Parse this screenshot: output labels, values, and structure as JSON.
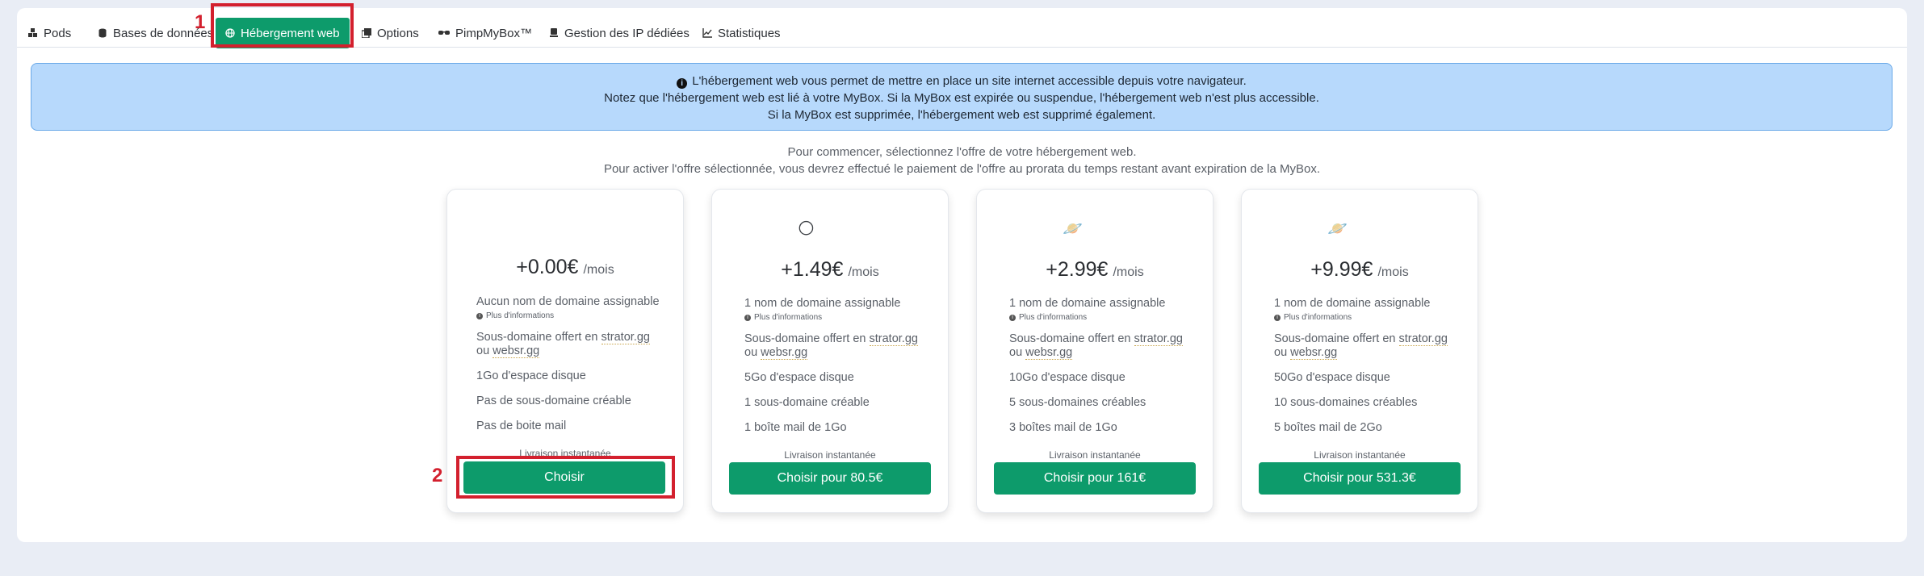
{
  "tabs": [
    {
      "label": "Pods",
      "icon": "pods-icon"
    },
    {
      "label": "Bases de données",
      "icon": "database-icon"
    },
    {
      "label": "Hébergement web",
      "icon": "globe-icon",
      "active": true
    },
    {
      "label": "Options",
      "icon": "options-icon"
    },
    {
      "label": "PimpMyBox™",
      "icon": "glasses-icon"
    },
    {
      "label": "Gestion des IP dédiées",
      "icon": "ip-icon"
    },
    {
      "label": "Statistiques",
      "icon": "chart-icon"
    }
  ],
  "annotations": {
    "one": "1",
    "two": "2"
  },
  "info": {
    "line1": "L'hébergement web vous permet de mettre en place un site internet accessible depuis votre navigateur.",
    "line2": "Notez que l'hébergement web est lié à votre MyBox. Si la MyBox est expirée ou suspendue, l'hébergement web n'est plus accessible.",
    "line3": "Si la MyBox est supprimée, l'hébergement web est supprimé également."
  },
  "intro": {
    "line1": "Pour commencer, sélectionnez l'offre de votre hébergement web.",
    "line2": "Pour activer l'offre sélectionnée, vous devrez effectué le paiement de l'offre au prorata du temps restant avant expiration de la MyBox."
  },
  "plans": [
    {
      "planet": "",
      "price": "+0.00€",
      "period": "/mois",
      "domain": "Aucun nom de domaine assignable",
      "more": "Plus d'informations",
      "sub_a": "Sous-domaine offert en ",
      "sub_b": "strator.gg",
      "sub_c": "ou ",
      "sub_d": "websr.gg",
      "disk": "1Go d'espace disque",
      "subdomains": "Pas de sous-domaine créable",
      "mail": "Pas de boite mail",
      "livraison": "Livraison instantanée",
      "button": "Choisir"
    },
    {
      "planet": "🌕",
      "price": "+1.49€",
      "period": "/mois",
      "domain": "1 nom de domaine assignable",
      "more": "Plus d'informations",
      "sub_a": "Sous-domaine offert en ",
      "sub_b": "strator.gg",
      "sub_c": "ou ",
      "sub_d": "websr.gg",
      "disk": "5Go d'espace disque",
      "subdomains": "1 sous-domaine créable",
      "mail": "1 boîte mail de 1Go",
      "livraison": "Livraison instantanée",
      "button": "Choisir pour 80.5€"
    },
    {
      "planet": "🪐",
      "price": "+2.99€",
      "period": "/mois",
      "domain": "1 nom de domaine assignable",
      "more": "Plus d'informations",
      "sub_a": "Sous-domaine offert en ",
      "sub_b": "strator.gg",
      "sub_c": "ou ",
      "sub_d": "websr.gg",
      "disk": "10Go d'espace disque",
      "subdomains": "5 sous-domaines créables",
      "mail": "3 boîtes mail de 1Go",
      "livraison": "Livraison instantanée",
      "button": "Choisir pour 161€"
    },
    {
      "planet": "🪐",
      "price": "+9.99€",
      "period": "/mois",
      "domain": "1 nom de domaine assignable",
      "more": "Plus d'informations",
      "sub_a": "Sous-domaine offert en ",
      "sub_b": "strator.gg",
      "sub_c": "ou ",
      "sub_d": "websr.gg",
      "disk": "50Go d'espace disque",
      "subdomains": "10 sous-domaines créables",
      "mail": "5 boîtes mail de 2Go",
      "livraison": "Livraison instantanée",
      "button": "Choisir pour 531.3€"
    }
  ]
}
